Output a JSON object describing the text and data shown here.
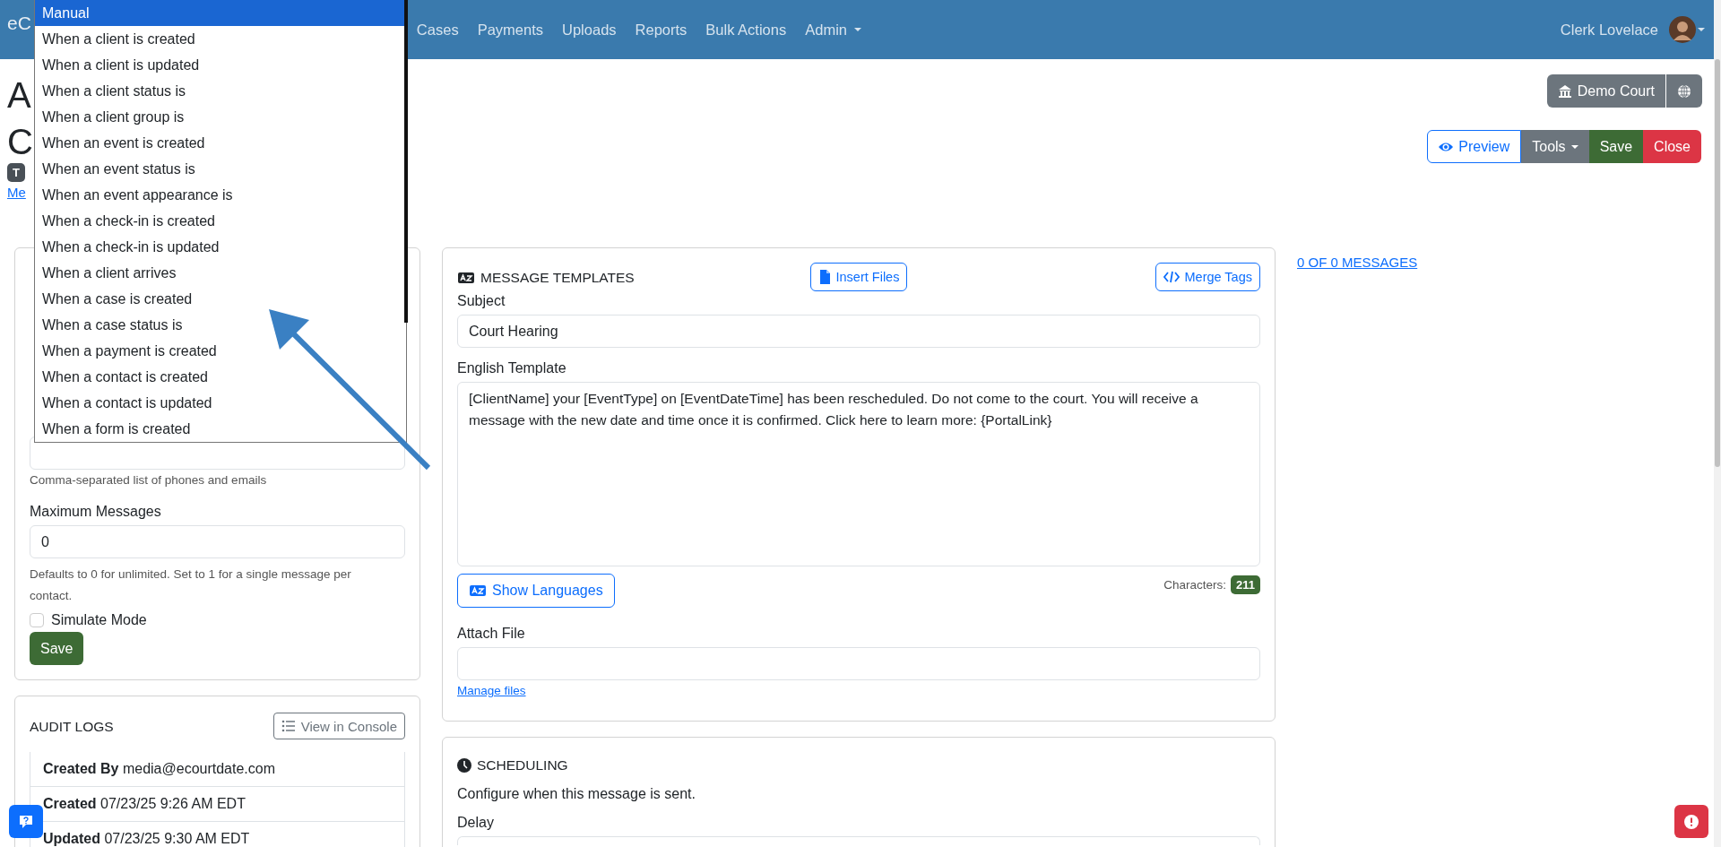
{
  "navbar": {
    "brand": "eC",
    "links": [
      "Cases",
      "Payments",
      "Uploads",
      "Reports",
      "Bulk Actions"
    ],
    "admin": "Admin",
    "user": "Clerk Lovelace"
  },
  "trigger_dropdown": {
    "options": [
      {
        "label": "Manual",
        "selected": true
      },
      {
        "label": "When a client is created",
        "selected": false
      },
      {
        "label": "When a client is updated",
        "selected": false
      },
      {
        "label": "When a client status is",
        "selected": false
      },
      {
        "label": "When a client group is",
        "selected": false
      },
      {
        "label": "When an event is created",
        "selected": false
      },
      {
        "label": "When an event status is",
        "selected": false
      },
      {
        "label": "When an event appearance is",
        "selected": false
      },
      {
        "label": "When a check-in is created",
        "selected": false
      },
      {
        "label": "When a check-in is updated",
        "selected": false
      },
      {
        "label": "When a client arrives",
        "selected": false
      },
      {
        "label": "When a case is created",
        "selected": false
      },
      {
        "label": "When a case status is",
        "selected": false
      },
      {
        "label": "When a payment is created",
        "selected": false
      },
      {
        "label": "When a contact is created",
        "selected": false
      },
      {
        "label": "When a contact is updated",
        "selected": false
      },
      {
        "label": "When a form is created",
        "selected": false
      }
    ]
  },
  "header": {
    "title": "A",
    "subtitle": "C",
    "badge": "T",
    "link": "Me",
    "court_button": "Demo Court",
    "actions": [
      {
        "label": "Preview",
        "kind": "outline"
      },
      {
        "label": "Tools",
        "kind": "dropdown"
      },
      {
        "label": "Save",
        "kind": "success"
      },
      {
        "label": "Close",
        "kind": "danger"
      }
    ]
  },
  "settings_card": {
    "recipients_help": "Comma-separated list of phones and emails",
    "max_messages": {
      "label": "Maximum Messages",
      "value": "0",
      "help": "Defaults to 0 for unlimited. Set to 1 for a single message per contact."
    },
    "simulate": {
      "label": "Simulate Mode",
      "checked": false
    },
    "save": "Save"
  },
  "audit_logs": {
    "title": "AUDIT LOGS",
    "button": "View in Console",
    "rows": [
      {
        "label": "Created By",
        "value": "media@ecourtdate.com"
      },
      {
        "label": "Created",
        "value": "07/23/25 9:26 AM EDT"
      },
      {
        "label": "Updated",
        "value": "07/23/25 9:30 AM EDT"
      }
    ]
  },
  "message_templates": {
    "title": "MESSAGE TEMPLATES",
    "insert_files": "Insert Files",
    "merge_tags": "Merge Tags",
    "subject": {
      "label": "Subject",
      "value": "Court Hearing"
    },
    "template": {
      "label": "English Template",
      "value": "[ClientName] your [EventType] on [EventDateTime] has been rescheduled. Do not come to the court. You will receive a message with the new date and time once it is confirmed. Click here to learn more: {PortalLink}"
    },
    "show_languages": "Show Languages",
    "characters": {
      "label": "Characters:",
      "count": "211"
    },
    "attach_file": {
      "label": "Attach File"
    },
    "manage_files": "Manage files"
  },
  "scheduling": {
    "title": "SCHEDULING",
    "description": "Configure when this message is sent.",
    "delay_label": "Delay"
  },
  "messages_link": "0 OF 0 MESSAGES"
}
